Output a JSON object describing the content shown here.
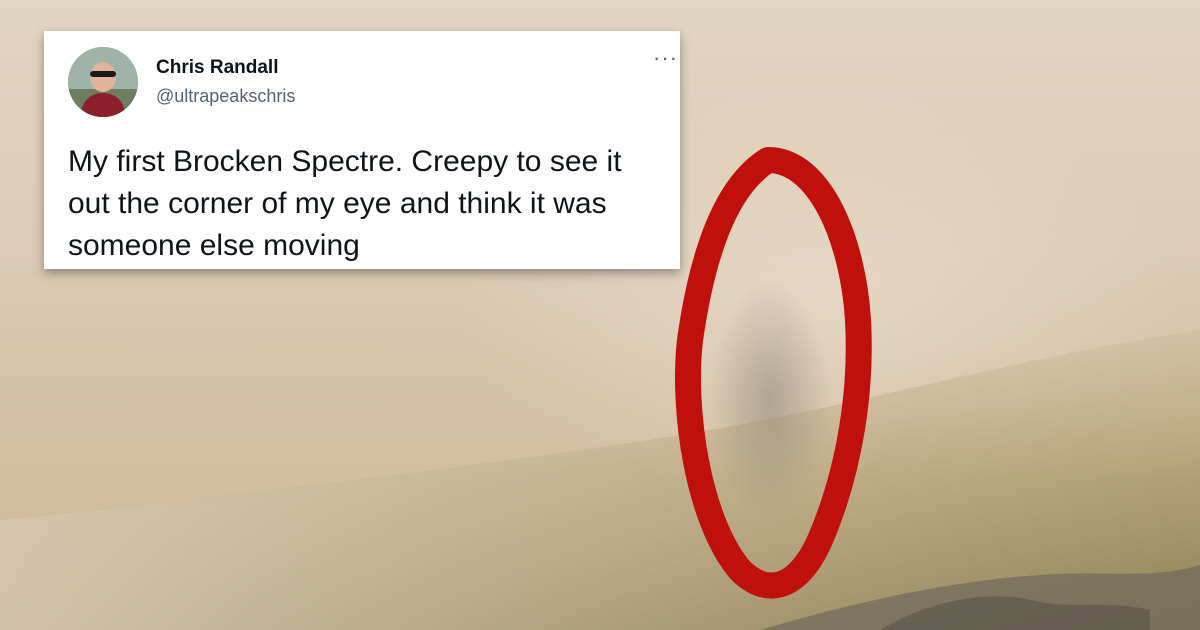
{
  "tweet": {
    "author_name": "Chris Randall",
    "author_handle": "@ultrapeakschris",
    "more_label": "···",
    "text": "My first Brocken Spectre. Creepy to see it out the corner of my eye and think it was someone else moving"
  },
  "colors": {
    "fog": "#dccbb5",
    "hillside": "#9a8a5a",
    "circle": "#c0100c"
  },
  "icons": {
    "avatar": "avatar-photo",
    "more": "more-dots-icon"
  }
}
